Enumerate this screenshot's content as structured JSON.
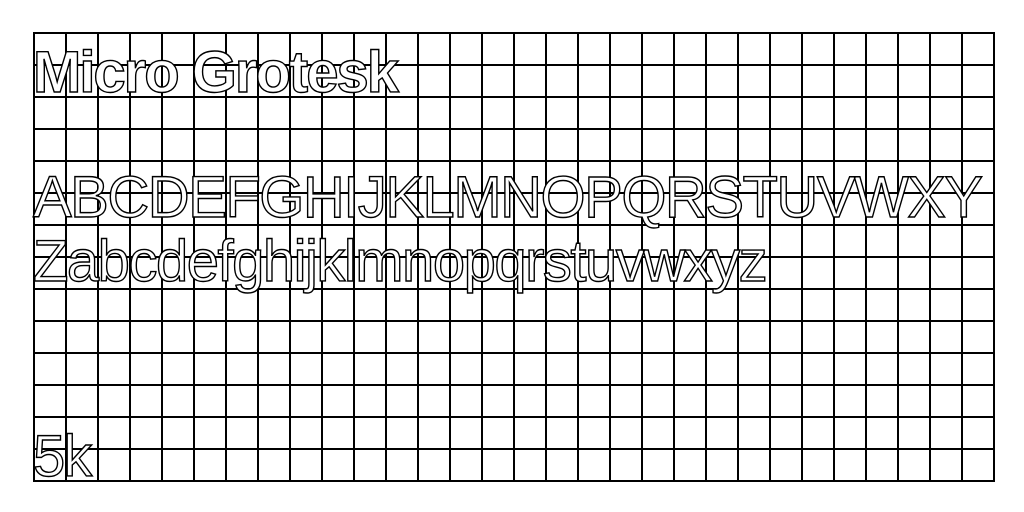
{
  "specimen": {
    "title": "Micro Grotesk",
    "alphabet": "ABCDEFGHIJKLMNOPQRSTUVWXYZabcdefghijklmnopqrstuvwxyz",
    "size_label": "5k"
  },
  "colors": {
    "background": "#ffffff",
    "grid_lines": "#000000",
    "glyph_outline": "#000000",
    "glyph_fill": "#ffffff"
  }
}
